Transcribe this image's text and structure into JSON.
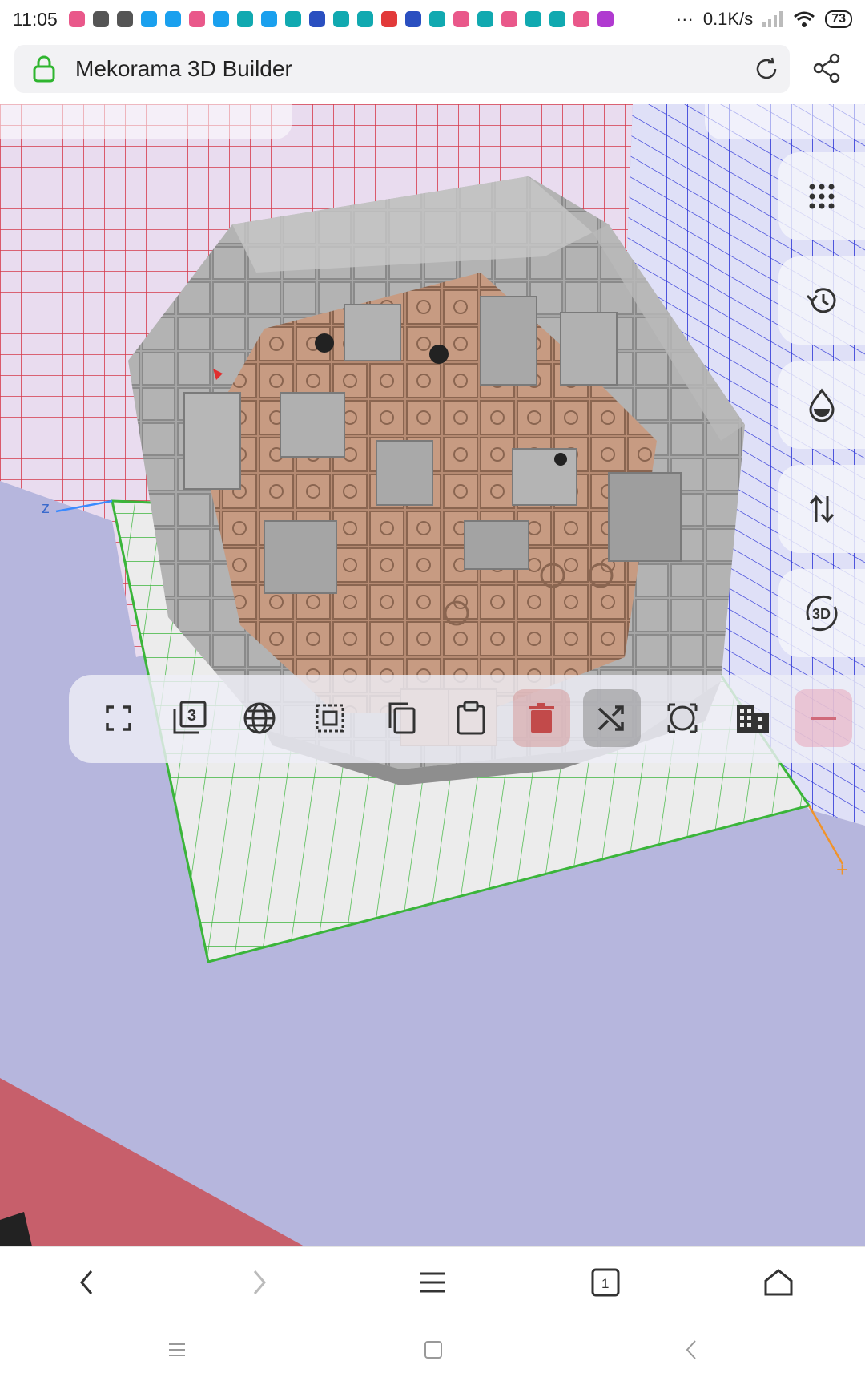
{
  "status_bar": {
    "time": "11:05",
    "network_speed": "0.1K/s",
    "battery": "73",
    "more": "···",
    "notif_colors": [
      "#e9588a",
      "#555555",
      "#555555",
      "#1aa0ee",
      "#1aa0ee",
      "#e9588a",
      "#1aa0ee",
      "#11a9b0",
      "#1aa0ee",
      "#11a9b0",
      "#2a4fc0",
      "#11a9b0",
      "#11a9b0",
      "#e23a3a",
      "#2a4fc0",
      "#11a9b0",
      "#e9588a",
      "#11a9b0",
      "#e9588a",
      "#11a9b0",
      "#11a9b0",
      "#e9588a",
      "#b03ad0"
    ]
  },
  "url_bar": {
    "title": "Mekorama 3D Builder",
    "lock_color": "#2fb52f"
  },
  "scene": {
    "axis_z_label": "z",
    "axis_x_label": "+",
    "grid_red": "#d63a4a",
    "grid_blue": "#2e36d8",
    "grid_green": "#3ab53a",
    "background": "#b6b6dd"
  },
  "side_tools": [
    {
      "name": "dots-grid-icon"
    },
    {
      "name": "history-icon"
    },
    {
      "name": "water-drop-icon"
    },
    {
      "name": "swap-vertical-icon"
    },
    {
      "name": "rotate-3d-icon",
      "label": "3D"
    }
  ],
  "toolbar": {
    "layers_badge": "3",
    "delete_color": "#c24a4a",
    "remove_color": "#d06a7a"
  },
  "browser_nav": {
    "tab_count": "1"
  }
}
